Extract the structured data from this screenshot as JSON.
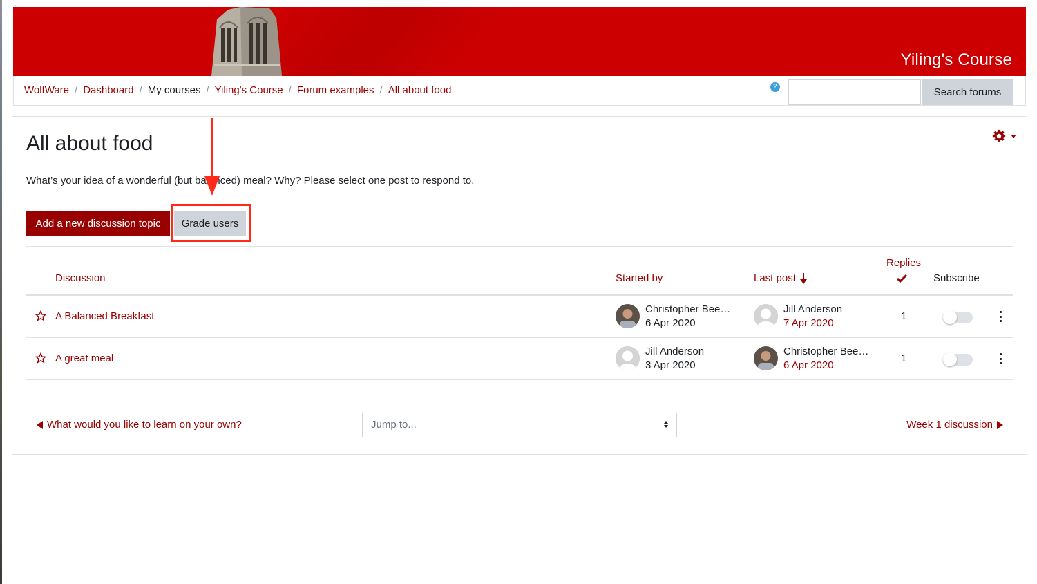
{
  "header": {
    "course_title": "Yiling's Course",
    "brand_color": "#cc0000"
  },
  "breadcrumb": [
    {
      "label": "WolfWare",
      "link": true
    },
    {
      "label": "Dashboard",
      "link": true
    },
    {
      "label": "My courses",
      "link": false
    },
    {
      "label": "Yiling's Course",
      "link": true
    },
    {
      "label": "Forum examples",
      "link": true
    },
    {
      "label": "All about food",
      "link": true
    }
  ],
  "search": {
    "help_icon": "question-circle-icon",
    "value": "",
    "placeholder": "",
    "button_label": "Search forums"
  },
  "forum": {
    "title": "All about food",
    "intro": "What’s your idea of a wonderful (but balanced) meal? Why? Please select one post to respond to.",
    "settings_icon": "gear-icon",
    "add_topic_label": "Add a new discussion topic",
    "grade_users_label": "Grade users",
    "accent_color": "#990000"
  },
  "table": {
    "columns": {
      "discussion": "Discussion",
      "started_by": "Started by",
      "last_post": "Last post",
      "replies": "Replies",
      "subscribe": "Subscribe"
    },
    "sort_icon": "arrow-down-icon",
    "replies_icon": "check-icon",
    "rows": [
      {
        "topic": "A Balanced Breakfast",
        "starter_name": "Christopher Bee…",
        "starter_avatar": "photo",
        "starter_date": "6 Apr 2020",
        "last_name": "Jill Anderson",
        "last_avatar": "default",
        "last_date": "7 Apr 2020",
        "replies": "1",
        "subscribed": false
      },
      {
        "topic": "A great meal",
        "starter_name": "Jill Anderson",
        "starter_avatar": "default",
        "starter_date": "3 Apr 2020",
        "last_name": "Christopher Bee…",
        "last_avatar": "photo",
        "last_date": "6 Apr 2020",
        "replies": "1",
        "subscribed": false
      }
    ]
  },
  "navigation": {
    "prev_label": "What would you like to learn on your own?",
    "jump_placeholder": "Jump to...",
    "next_label": "Week 1 discussion"
  },
  "annotation": {
    "highlight_target": "Grade users",
    "color": "#ff2a1a"
  }
}
